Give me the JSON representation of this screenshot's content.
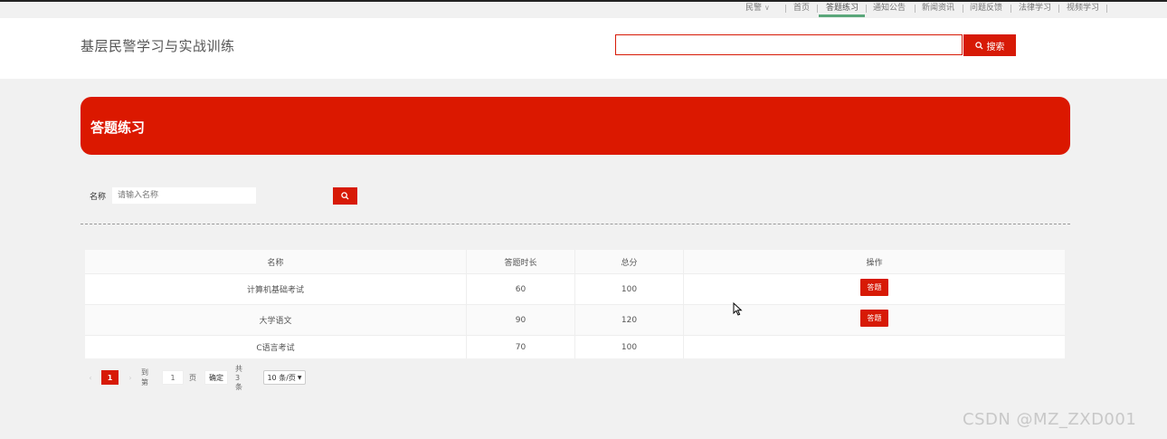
{
  "topnav": {
    "user": "民警",
    "items": [
      "首页",
      "答题练习",
      "通知公告",
      "新闻资讯",
      "问题反馈",
      "法律学习",
      "视频学习"
    ]
  },
  "header": {
    "site_title": "基层民警学习与实战训练",
    "search_value": "",
    "search_button": "搜索"
  },
  "banner": {
    "title": "答题练习"
  },
  "filter": {
    "label": "名称",
    "placeholder": "请输入名称"
  },
  "table": {
    "columns": [
      "名称",
      "答题时长",
      "总分",
      "操作"
    ],
    "rows": [
      {
        "name": "计算机基础考试",
        "duration": "60",
        "score": "100",
        "action": "答题"
      },
      {
        "name": "大学语文",
        "duration": "90",
        "score": "120",
        "action": "答题"
      },
      {
        "name": "C语言考试",
        "duration": "70",
        "score": "100",
        "action": ""
      }
    ]
  },
  "pagination": {
    "current_page": "1",
    "goto_label": "到第",
    "goto_value": "1",
    "page_unit": "页",
    "confirm": "确定",
    "total": "共 3 条",
    "page_size": "10 条/页"
  },
  "watermark": "CSDN @MZ_ZXD001",
  "colors": {
    "accent": "#d71a06",
    "active_tab_underline": "#5aa77a",
    "background": "#f1f1f1"
  }
}
